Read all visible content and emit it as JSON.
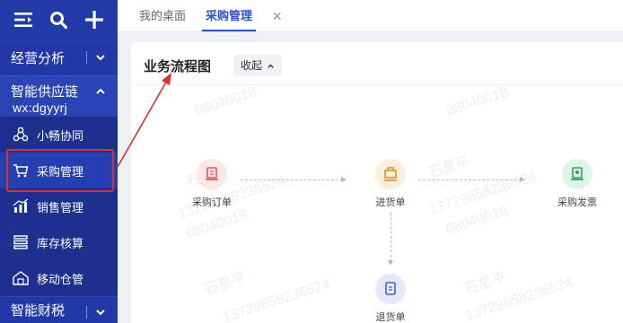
{
  "sidebar": {
    "sections": {
      "analysis": "经营分析",
      "supply_chain": "智能供应链",
      "finance": "智能财税"
    },
    "overlay_text": "wx:dgyyrj",
    "items": [
      {
        "label": "小畅协同",
        "icon": "collab-icon"
      },
      {
        "label": "采购管理",
        "icon": "cart-icon"
      },
      {
        "label": "销售管理",
        "icon": "chart-icon"
      },
      {
        "label": "库存核算",
        "icon": "warehouse-icon"
      },
      {
        "label": "移动仓管",
        "icon": "mobile-warehouse-icon"
      }
    ]
  },
  "tabs": {
    "home": "我的桌面",
    "active": "采购管理",
    "close": "✕"
  },
  "card": {
    "title": "业务流程图",
    "collapse_label": "收起"
  },
  "flow": {
    "nodes": [
      {
        "label": "采购订单",
        "color": "#e8565a",
        "bg": "#fde7e7"
      },
      {
        "label": "进货单",
        "color": "#e08c2c",
        "bg": "#fdeed9"
      },
      {
        "label": "采购发票",
        "color": "#2fa35e",
        "bg": "#dff3e6"
      },
      {
        "label": "退货单",
        "color": "#3f63d6",
        "bg": "#e3e9fb"
      }
    ]
  },
  "watermark": {
    "name": "石星平",
    "phone_a": "08040018",
    "phone_b": "13729658236524"
  },
  "colors": {
    "sidebar": "#2238a6",
    "accent": "#2b4fd8",
    "highlight": "#e62b2b"
  }
}
